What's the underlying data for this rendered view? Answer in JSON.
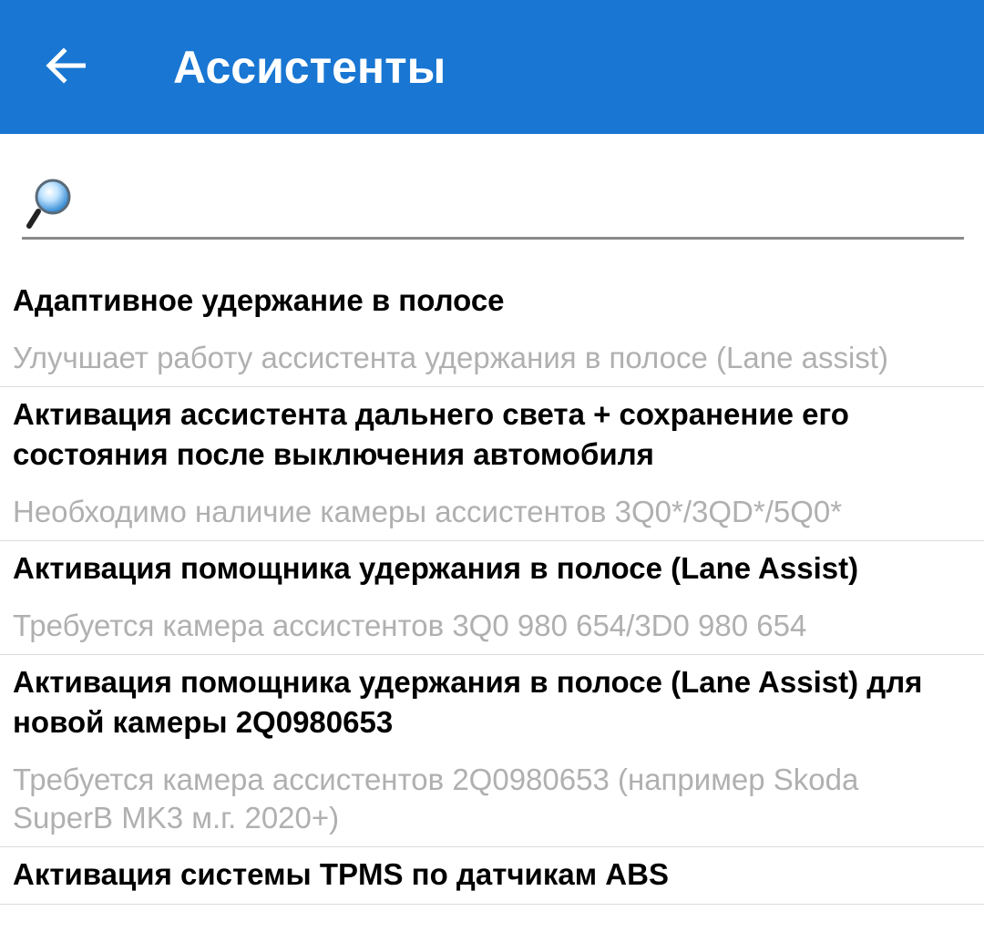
{
  "app_bar": {
    "title": "Ассистенты",
    "bg_color": "#1976d2",
    "back_icon": "arrow-left-icon"
  },
  "search": {
    "icon": "magnifier-icon",
    "value": "",
    "placeholder": ""
  },
  "items": [
    {
      "title": "Адаптивное удержание в полосе",
      "description": "Улучшает работу ассистента удержания в полосе (Lane assist)"
    },
    {
      "title": "Активация ассистента дальнего света + сохранение его состояния после выключения автомобиля",
      "description": "Необходимо наличие камеры ассистентов 3Q0*/3QD*/5Q0*"
    },
    {
      "title": "Активация помощника удержания в полосе (Lane Assist)",
      "description": "Требуется камера ассистентов 3Q0 980 654/3D0 980 654"
    },
    {
      "title": "Активация помощника удержания в полосе (Lane Assist) для новой камеры 2Q0980653",
      "description": "Требуется камера ассистентов 2Q0980653 (например Skoda SuperB MK3 м.г. 2020+)"
    },
    {
      "title": "Активация системы TPMS по датчикам ABS",
      "description": ""
    }
  ]
}
